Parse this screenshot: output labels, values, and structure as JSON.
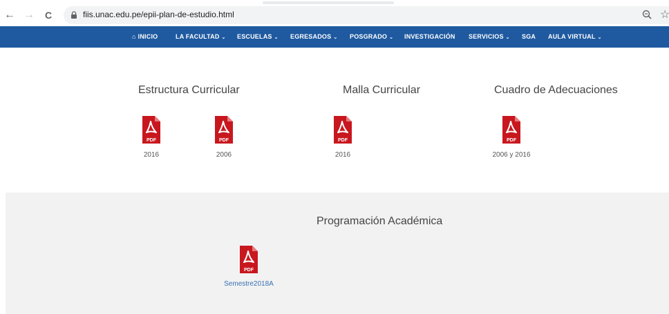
{
  "browser": {
    "url": "fiis.unac.edu.pe/epii-plan-de-estudio.html",
    "back_icon": "←",
    "forward_icon": "→",
    "reload_icon": "C",
    "star_icon": "☆"
  },
  "nav": {
    "items": [
      {
        "label": "INICIO",
        "caret": ""
      },
      {
        "label": "LA FACULTAD",
        "caret": "⌄"
      },
      {
        "label": "ESCUELAS",
        "caret": "⌄"
      },
      {
        "label": "EGRESADOS",
        "caret": "⌄"
      },
      {
        "label": "POSGRADO",
        "caret": "⌄"
      },
      {
        "label": "INVESTIGACIÓN",
        "caret": ""
      },
      {
        "label": "SERVICIOS",
        "caret": "⌄"
      },
      {
        "label": "SGA",
        "caret": ""
      },
      {
        "label": "AULA VIRTUAL",
        "caret": "⌄"
      }
    ],
    "bar_color": "#1f5aa0"
  },
  "sections": {
    "estructura": {
      "title": "Estructura Curricular",
      "docs": [
        {
          "label": "2016"
        },
        {
          "label": "2006"
        }
      ]
    },
    "malla": {
      "title": "Malla Curricular",
      "docs": [
        {
          "label": "2016"
        }
      ]
    },
    "cuadro": {
      "title": "Cuadro de Adecuaciones",
      "docs": [
        {
          "label": "2006 y 2016"
        }
      ]
    },
    "programacion": {
      "title": "Programación Académica",
      "docs": [
        {
          "label": "Semestre2018A"
        }
      ]
    }
  },
  "pdf_icon": {
    "text": "PDF",
    "color": "#c8171e",
    "fold_color": "#e9797c"
  }
}
